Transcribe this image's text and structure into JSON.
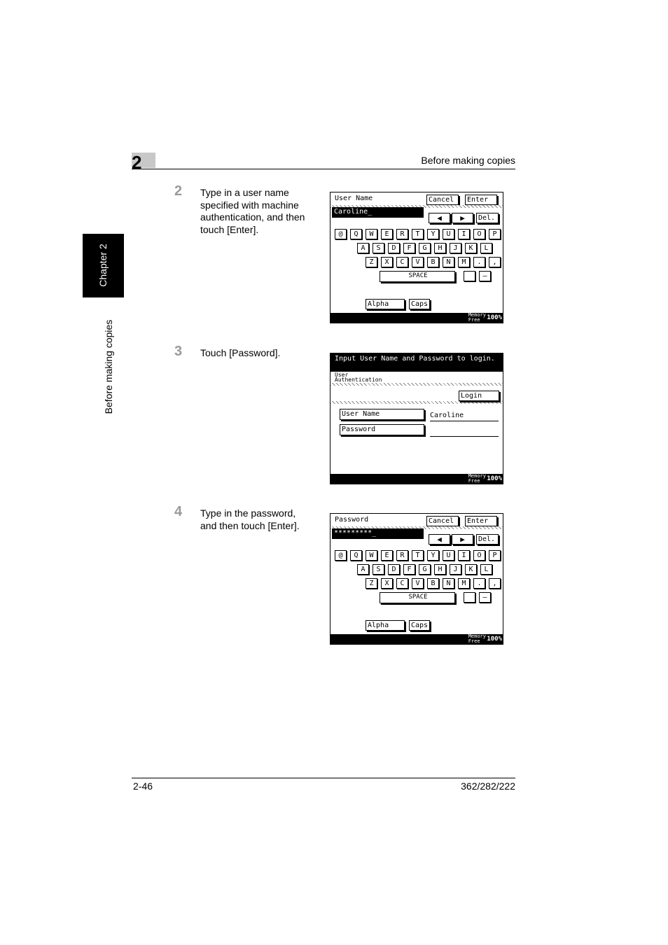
{
  "header": {
    "chapter_number": "2",
    "section_title": "Before making copies"
  },
  "side_tab": {
    "chapter_label": "Chapter 2",
    "section_label": "Before making copies"
  },
  "steps": [
    {
      "number": "2",
      "lines": [
        "Type in a user name",
        "specified with machine",
        "authentication, and then",
        "touch [Enter]."
      ]
    },
    {
      "number": "3",
      "lines": [
        "Touch [Password]."
      ]
    },
    {
      "number": "4",
      "lines": [
        "Type in the password,",
        "and then touch [Enter]."
      ]
    }
  ],
  "keyboard_screen_1": {
    "field_label": "User Name",
    "cancel": "Cancel",
    "enter": "Enter",
    "field_value": "Caroline_",
    "del": "Del.",
    "left_arrow": "◀",
    "right_arrow": "▶",
    "row1": [
      "@",
      "Q",
      "W",
      "E",
      "R",
      "T",
      "Y",
      "U",
      "I",
      "O",
      "P"
    ],
    "row2": [
      "A",
      "S",
      "D",
      "F",
      "G",
      "H",
      "J",
      "K",
      "L"
    ],
    "row3": [
      "Z",
      "X",
      "C",
      "V",
      "B",
      "N",
      "M",
      ".",
      ","
    ],
    "space": "SPACE",
    "minus": "—",
    "alpha": "Alpha",
    "caps": "Caps",
    "memory_label_1": "Memory",
    "memory_label_2": "Free",
    "memory_value": "100%"
  },
  "auth_screen": {
    "title": "Input User Name and Password to login.",
    "subtitle_1": "User",
    "subtitle_2": "Authentication",
    "login": "Login",
    "user_name_btn": "User Name",
    "user_name_value": "Caroline",
    "password_btn": "Password",
    "password_value": "",
    "memory_label_1": "Memory",
    "memory_label_2": "Free",
    "memory_value": "100%"
  },
  "keyboard_screen_2": {
    "field_label": "Password",
    "cancel": "Cancel",
    "enter": "Enter",
    "field_value": "*********_",
    "del": "Del.",
    "left_arrow": "◀",
    "right_arrow": "▶",
    "row1": [
      "@",
      "Q",
      "W",
      "E",
      "R",
      "T",
      "Y",
      "U",
      "I",
      "O",
      "P"
    ],
    "row2": [
      "A",
      "S",
      "D",
      "F",
      "G",
      "H",
      "J",
      "K",
      "L"
    ],
    "row3": [
      "Z",
      "X",
      "C",
      "V",
      "B",
      "N",
      "M",
      ".",
      ","
    ],
    "space": "SPACE",
    "minus": "—",
    "alpha": "Alpha",
    "caps": "Caps",
    "memory_label_1": "Memory",
    "memory_label_2": "Free",
    "memory_value": "100%"
  },
  "footer": {
    "page_number": "2-46",
    "model": "362/282/222"
  }
}
